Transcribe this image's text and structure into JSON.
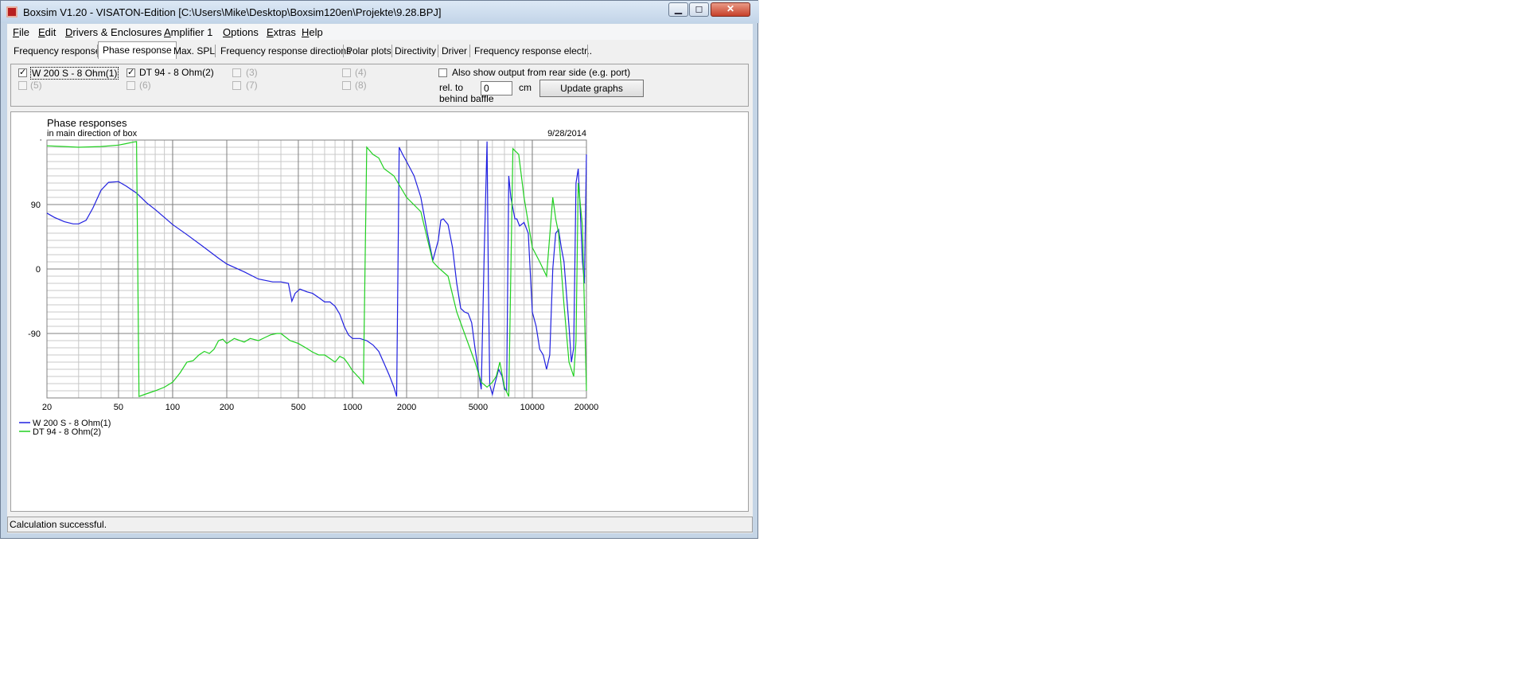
{
  "window": {
    "title": "Boxsim V1.20 - VISATON-Edition [C:\\Users\\Mike\\Desktop\\Boxsim120en\\Projekte\\9.28.BPJ]",
    "minimize_label": "▁",
    "maximize_label": "◻",
    "close_label": "✕"
  },
  "menu": [
    {
      "label": "File"
    },
    {
      "label": "Edit"
    },
    {
      "label": "Drivers & Enclosures"
    },
    {
      "label": "Amplifier 1"
    },
    {
      "label": "Options"
    },
    {
      "label": "Extras"
    },
    {
      "label": "Help"
    }
  ],
  "tabs": [
    {
      "label": "Frequency response.",
      "active": false
    },
    {
      "label": "Phase response",
      "active": true
    },
    {
      "label": "Max. SPL",
      "active": false
    },
    {
      "label": "Frequency response directions",
      "active": false
    },
    {
      "label": "Polar plots",
      "active": false
    },
    {
      "label": "Directivity",
      "active": false
    },
    {
      "label": "Driver",
      "active": false
    },
    {
      "label": "Frequency response electr..",
      "active": false
    }
  ],
  "drivers": [
    {
      "label": "W 200 S - 8 Ohm(1)",
      "checked": true,
      "enabled": true
    },
    {
      "label": "DT 94 - 8 Ohm(2)",
      "checked": true,
      "enabled": true
    },
    {
      "label": "(3)",
      "checked": false,
      "enabled": false
    },
    {
      "label": "(4)",
      "checked": false,
      "enabled": false
    },
    {
      "label": "(5)",
      "checked": false,
      "enabled": false
    },
    {
      "label": "(6)",
      "checked": false,
      "enabled": false
    },
    {
      "label": "(7)",
      "checked": false,
      "enabled": false
    },
    {
      "label": "(8)",
      "checked": false,
      "enabled": false
    }
  ],
  "rear_output": {
    "label": "Also show output from rear side (e.g. port)",
    "checked": false,
    "rel_label_1": "rel. to",
    "rel_label_2": "behind baffle",
    "offset_value": "0",
    "unit": "cm",
    "update_button": "Update graphs"
  },
  "status": "Calculation successful.",
  "chart_data": {
    "type": "line",
    "title": "Phase responses",
    "subtitle": "in main direction of box",
    "date": "9/28/2014",
    "x_scale": "log",
    "xlim": [
      20,
      20000
    ],
    "ylim": [
      -180,
      180
    ],
    "x_ticks": [
      20,
      50,
      100,
      200,
      500,
      1000,
      2000,
      5000,
      10000,
      20000
    ],
    "y_ticks": [
      90,
      0,
      -90
    ],
    "y_top_tick_label": "·",
    "grid": true,
    "legend_position": "bottom-left",
    "colors": {
      "series1": "#2020e0",
      "series2": "#20d020",
      "grid_major": "#808080",
      "grid_minor": "#c8c8c8"
    },
    "series": [
      {
        "name": "W 200 S - 8 Ohm(1)",
        "color": "#2020e0",
        "points": [
          [
            20,
            78
          ],
          [
            22,
            72
          ],
          [
            25,
            66
          ],
          [
            28,
            63
          ],
          [
            30,
            63
          ],
          [
            33,
            68
          ],
          [
            36,
            85
          ],
          [
            40,
            110
          ],
          [
            44,
            121
          ],
          [
            50,
            122
          ],
          [
            55,
            116
          ],
          [
            63,
            106
          ],
          [
            72,
            92
          ],
          [
            80,
            83
          ],
          [
            90,
            72
          ],
          [
            100,
            62
          ],
          [
            120,
            48
          ],
          [
            150,
            30
          ],
          [
            180,
            15
          ],
          [
            200,
            7
          ],
          [
            250,
            -4
          ],
          [
            300,
            -14
          ],
          [
            360,
            -18
          ],
          [
            400,
            -18
          ],
          [
            440,
            -20
          ],
          [
            460,
            -45
          ],
          [
            480,
            -34
          ],
          [
            510,
            -28
          ],
          [
            560,
            -32
          ],
          [
            600,
            -34
          ],
          [
            650,
            -40
          ],
          [
            700,
            -46
          ],
          [
            750,
            -46
          ],
          [
            800,
            -52
          ],
          [
            850,
            -63
          ],
          [
            900,
            -80
          ],
          [
            950,
            -92
          ],
          [
            1000,
            -97
          ],
          [
            1100,
            -97
          ],
          [
            1200,
            -100
          ],
          [
            1300,
            -106
          ],
          [
            1400,
            -115
          ],
          [
            1500,
            -132
          ],
          [
            1600,
            -148
          ],
          [
            1700,
            -165
          ],
          [
            1760,
            -178
          ],
          [
            1820,
            170
          ],
          [
            1900,
            160
          ],
          [
            2000,
            150
          ],
          [
            2200,
            130
          ],
          [
            2400,
            100
          ],
          [
            2600,
            52
          ],
          [
            2800,
            12
          ],
          [
            3000,
            40
          ],
          [
            3100,
            68
          ],
          [
            3200,
            70
          ],
          [
            3400,
            62
          ],
          [
            3600,
            30
          ],
          [
            3800,
            -20
          ],
          [
            4000,
            -55
          ],
          [
            4200,
            -60
          ],
          [
            4400,
            -62
          ],
          [
            4600,
            -75
          ],
          [
            4800,
            -110
          ],
          [
            5000,
            -140
          ],
          [
            5200,
            -168
          ],
          [
            5400,
            20
          ],
          [
            5600,
            178
          ],
          [
            5700,
            -20
          ],
          [
            5800,
            -162
          ],
          [
            6000,
            -175
          ],
          [
            6200,
            -160
          ],
          [
            6500,
            -140
          ],
          [
            6800,
            -150
          ],
          [
            7000,
            -168
          ],
          [
            7200,
            -170
          ],
          [
            7400,
            130
          ],
          [
            7600,
            100
          ],
          [
            8000,
            70
          ],
          [
            8200,
            70
          ],
          [
            8500,
            60
          ],
          [
            9000,
            65
          ],
          [
            9500,
            50
          ],
          [
            10000,
            -60
          ],
          [
            10500,
            -80
          ],
          [
            11000,
            -112
          ],
          [
            11500,
            -120
          ],
          [
            12000,
            -140
          ],
          [
            12500,
            -120
          ],
          [
            13000,
            0
          ],
          [
            13500,
            50
          ],
          [
            14000,
            55
          ],
          [
            14500,
            30
          ],
          [
            15000,
            10
          ],
          [
            16000,
            -80
          ],
          [
            16500,
            -130
          ],
          [
            17000,
            -110
          ],
          [
            17500,
            120
          ],
          [
            18000,
            140
          ],
          [
            18500,
            80
          ],
          [
            19000,
            10
          ],
          [
            19500,
            -20
          ],
          [
            20000,
            160
          ]
        ]
      },
      {
        "name": "DT 94 - 8 Ohm(2)",
        "color": "#20d020",
        "points": [
          [
            20,
            172
          ],
          [
            25,
            171
          ],
          [
            30,
            170
          ],
          [
            40,
            171
          ],
          [
            50,
            173
          ],
          [
            55,
            175
          ],
          [
            60,
            177
          ],
          [
            63,
            178
          ],
          [
            65,
            -178
          ],
          [
            70,
            -175
          ],
          [
            80,
            -170
          ],
          [
            90,
            -165
          ],
          [
            100,
            -158
          ],
          [
            110,
            -145
          ],
          [
            120,
            -130
          ],
          [
            130,
            -128
          ],
          [
            140,
            -120
          ],
          [
            150,
            -115
          ],
          [
            160,
            -118
          ],
          [
            170,
            -112
          ],
          [
            180,
            -100
          ],
          [
            190,
            -98
          ],
          [
            200,
            -104
          ],
          [
            220,
            -97
          ],
          [
            250,
            -102
          ],
          [
            270,
            -97
          ],
          [
            300,
            -100
          ],
          [
            330,
            -95
          ],
          [
            350,
            -92
          ],
          [
            380,
            -90
          ],
          [
            400,
            -90
          ],
          [
            450,
            -100
          ],
          [
            500,
            -104
          ],
          [
            550,
            -110
          ],
          [
            600,
            -116
          ],
          [
            650,
            -120
          ],
          [
            700,
            -120
          ],
          [
            750,
            -125
          ],
          [
            800,
            -130
          ],
          [
            850,
            -122
          ],
          [
            900,
            -125
          ],
          [
            950,
            -133
          ],
          [
            1000,
            -142
          ],
          [
            1100,
            -153
          ],
          [
            1150,
            -160
          ],
          [
            1200,
            170
          ],
          [
            1300,
            160
          ],
          [
            1400,
            155
          ],
          [
            1500,
            140
          ],
          [
            1700,
            130
          ],
          [
            2000,
            100
          ],
          [
            2400,
            80
          ],
          [
            2800,
            10
          ],
          [
            3000,
            2
          ],
          [
            3400,
            -10
          ],
          [
            3800,
            -60
          ],
          [
            4200,
            -90
          ],
          [
            4800,
            -130
          ],
          [
            5200,
            -158
          ],
          [
            5600,
            -165
          ],
          [
            6000,
            -158
          ],
          [
            6300,
            -150
          ],
          [
            6600,
            -130
          ],
          [
            7000,
            -165
          ],
          [
            7400,
            -178
          ],
          [
            7800,
            168
          ],
          [
            8400,
            160
          ],
          [
            9000,
            100
          ],
          [
            10000,
            30
          ],
          [
            11000,
            10
          ],
          [
            12000,
            -10
          ],
          [
            13000,
            100
          ],
          [
            13500,
            70
          ],
          [
            14000,
            50
          ],
          [
            15000,
            -50
          ],
          [
            16000,
            -130
          ],
          [
            17000,
            -150
          ],
          [
            17500,
            -100
          ],
          [
            18000,
            120
          ],
          [
            19000,
            60
          ],
          [
            20000,
            -170
          ]
        ]
      }
    ]
  }
}
